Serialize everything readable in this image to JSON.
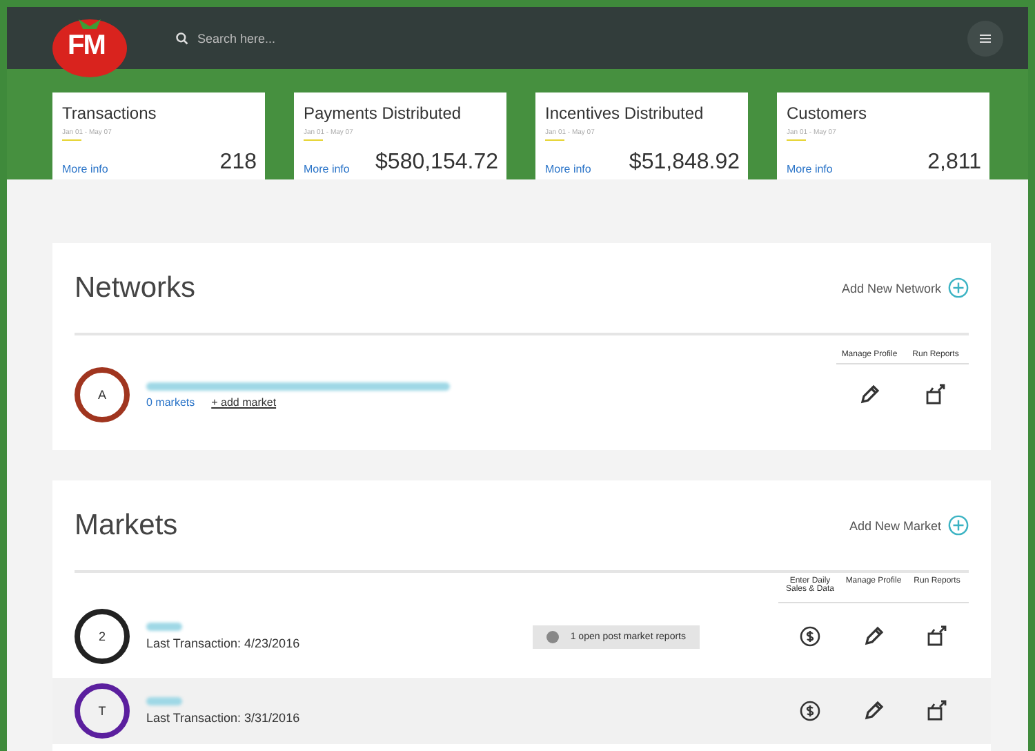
{
  "header": {
    "logo": "FM",
    "search": {
      "placeholder": "Search here..."
    }
  },
  "stats": [
    {
      "title": "Transactions",
      "range": "Jan 01 - May 07",
      "link": "More info",
      "value": "218"
    },
    {
      "title": "Payments Distributed",
      "range": "Jan 01 - May 07",
      "link": "More info",
      "value": "$580,154.72"
    },
    {
      "title": "Incentives Distributed",
      "range": "Jan 01 - May 07",
      "link": "More info",
      "value": "$51,848.92"
    },
    {
      "title": "Customers",
      "range": "Jan 01 - May 07",
      "link": "More info",
      "value": "2,811"
    }
  ],
  "networks": {
    "title": "Networks",
    "add": "Add New Network",
    "columns": [
      "Manage Profile",
      "Run Reports"
    ],
    "rows": [
      {
        "initial": "A",
        "color": "#a0351f",
        "count": "0 markets",
        "add": "+ add market"
      }
    ]
  },
  "markets": {
    "title": "Markets",
    "add": "Add New Market",
    "columns": [
      "Enter Daily Sales & Data",
      "Manage Profile",
      "Run Reports"
    ],
    "rows": [
      {
        "initial": "2",
        "color": "#222222",
        "last": "Last Transaction: 4/23/2016",
        "badge": "1 open post market reports",
        "selected": false
      },
      {
        "initial": "T",
        "color": "#5b1f9e",
        "last": "Last Transaction: 3/31/2016",
        "selected": true
      }
    ]
  }
}
